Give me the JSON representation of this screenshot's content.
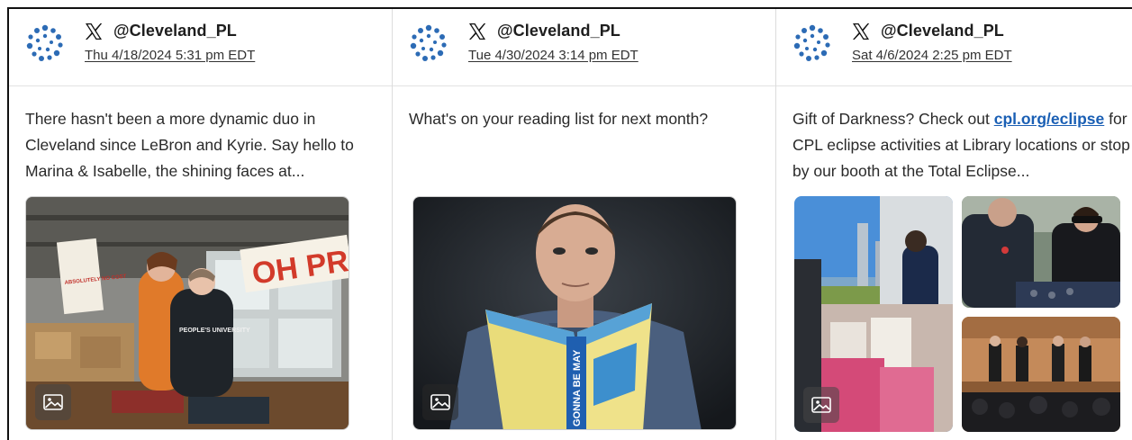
{
  "posts": [
    {
      "handle": "@Cleveland_PL",
      "timestamp": "Thu 4/18/2024 5:31 pm EDT",
      "text": "There hasn't been a more dynamic duo in Cleveland since LeBron and Kyrie. Say hello to Marina & Isabelle, the shining faces at...",
      "photo_sign_top": "OH PRESS",
      "photo_sign_left": "ABSOLUTELY NO COST",
      "photo_shirt": "PEOPLE'S UNIVERSITY"
    },
    {
      "handle": "@Cleveland_PL",
      "timestamp": "Tue 4/30/2024 3:14 pm EDT",
      "text": "What's on your reading list for next month?",
      "book_spine": "GONNA BE MAY"
    },
    {
      "handle": "@Cleveland_PL",
      "timestamp": "Sat 4/6/2024 2:25 pm EDT",
      "text_before": "Gift of Darkness? Check out ",
      "link": "cpl.org/eclipse",
      "text_after": " for CPL eclipse activities at Library locations or stop by our booth at the Total Eclipse..."
    }
  ],
  "colors": {
    "link": "#1a5fb4",
    "avatar_blue": "#2c6bb5"
  },
  "icons": {
    "platform": "x-logo-icon",
    "media": "image-icon",
    "avatar": "library-logo-icon"
  }
}
